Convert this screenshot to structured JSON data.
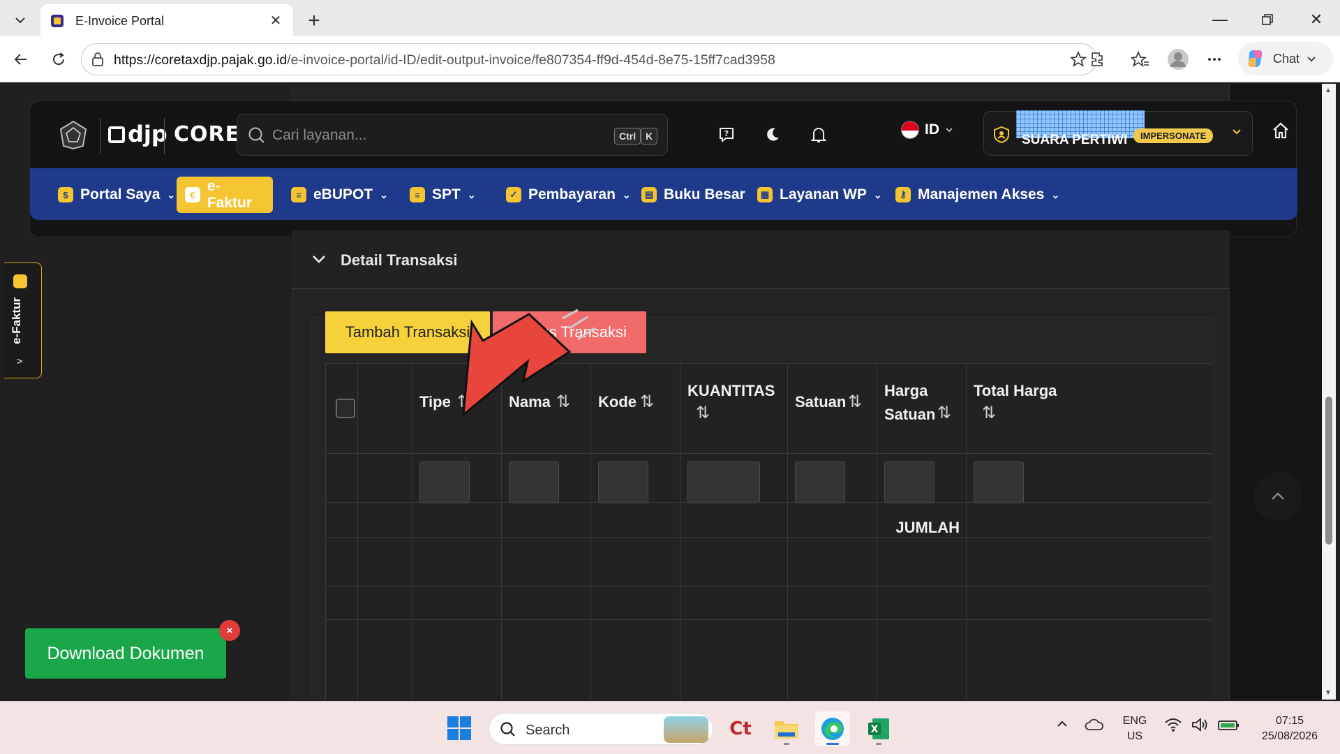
{
  "browser": {
    "tab_title": "E-Invoice Portal",
    "url_host": "https://coretaxdjp.pajak.go.id",
    "url_path": "/e-invoice-portal/id-ID/edit-output-invoice/fe807354-ff9d-454d-8e75-15ff7cad3958",
    "chat_label": "Chat"
  },
  "header": {
    "logo_djp": "djp",
    "logo_coretax": "CORETAX",
    "search_placeholder": "Cari layanan...",
    "kbd_ctrl": "Ctrl",
    "kbd_k": "K",
    "language": "ID",
    "user_name": "SUARA PERTIWI",
    "impersonate_badge": "IMPERSONATE"
  },
  "nav": {
    "items": [
      {
        "label": "Portal Saya",
        "icon": "portal-icon",
        "has_chevron": true
      },
      {
        "label": "e-Faktur",
        "icon": "efaktur-icon",
        "active": true
      },
      {
        "label": "eBUPOT",
        "icon": "ebupot-icon",
        "has_chevron": true
      },
      {
        "label": "SPT",
        "icon": "spt-icon",
        "has_chevron": true
      },
      {
        "label": "Pembayaran",
        "icon": "payment-icon",
        "has_chevron": true
      },
      {
        "label": "Buku Besar",
        "icon": "ledger-icon"
      },
      {
        "label": "Layanan WP",
        "icon": "services-icon",
        "has_chevron": true
      },
      {
        "label": "Manajemen Akses",
        "icon": "access-icon",
        "has_chevron": true
      }
    ]
  },
  "section": {
    "title": "Detail Transaksi",
    "add_button": "Tambah Transaksi",
    "delete_button": "Hapus Transaksi"
  },
  "table": {
    "columns": [
      {
        "label": "Tipe"
      },
      {
        "label": "Nama"
      },
      {
        "label": "Kode"
      },
      {
        "label": "KUANTITAS"
      },
      {
        "label": "Satuan"
      },
      {
        "label": "Harga",
        "label2": "Satuan"
      },
      {
        "label": "Total Harga"
      }
    ],
    "summary_label": "JUMLAH"
  },
  "sidebar_tab": {
    "label": "e-Faktur",
    "arrow": ">"
  },
  "download": {
    "label": "Download Dokumen",
    "close": "×"
  },
  "taskbar": {
    "search_label": "Search",
    "lang_line1": "ENG",
    "lang_line2": "US",
    "time": "07:15",
    "date": "25/08/2026"
  },
  "colors": {
    "nav_blue": "#1f3a8a",
    "accent_yellow": "#f5c431",
    "delete_red": "#f26b6b",
    "download_green": "#1aa74a"
  }
}
